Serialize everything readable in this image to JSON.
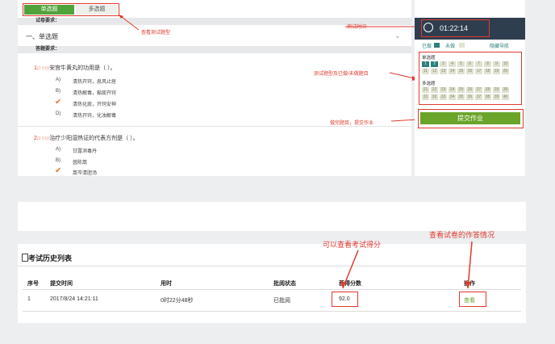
{
  "exam": {
    "type_tabs": [
      "单选题",
      "多选题"
    ],
    "paper_req_label": "试卷要求：",
    "section_title": "一、单选题",
    "answer_req_label": "答题要求：",
    "questions": [
      {
        "num": "1",
        "tag": "(2.0分)",
        "text": "安宫牛黄丸的功用是（ ）。",
        "options": [
          {
            "key": "A)",
            "text": "清热开窍，息风止痉"
          },
          {
            "key": "B)",
            "text": "清热解毒，豁痰开窍"
          },
          {
            "key": "C)",
            "text": "清热化痰，开窍安神"
          },
          {
            "key": "D)",
            "text": "清热开窍，化浊解毒"
          }
        ]
      },
      {
        "num": "2",
        "tag": "(2.0分)",
        "text": "治疗少阳湿热证的代表方剂是（ ）。",
        "options": [
          {
            "key": "A)",
            "text": "甘露消毒丹"
          },
          {
            "key": "B)",
            "text": "茵陈蒿"
          },
          {
            "key": "C)",
            "text": "蒿芩清胆汤"
          }
        ]
      }
    ],
    "annotations": {
      "view_types": "查看测试题型",
      "timer": "测试时间",
      "nav": "测试题型及已做/未做题目",
      "submit": "做完题目，提交作业"
    }
  },
  "sidebar": {
    "timer": "01:22:14",
    "legend": {
      "done": "已做",
      "undone": "未做",
      "hide": "隐藏导航"
    },
    "single_label": "单选题",
    "multi_label": "多选题",
    "single_nums": [
      "1",
      "2",
      "3",
      "4",
      "5",
      "6",
      "7",
      "8",
      "9",
      "10",
      "11",
      "12",
      "13",
      "14",
      "15",
      "16",
      "17",
      "18",
      "19",
      "20"
    ],
    "multi_nums": [
      "21",
      "22",
      "23",
      "24",
      "25",
      "26",
      "27",
      "28",
      "29",
      "30",
      "31",
      "32",
      "33",
      "34",
      "35",
      "36",
      "37",
      "38",
      "39",
      "40"
    ],
    "submit_label": "提交作业",
    "colors": {
      "bg": "#2f3e4f",
      "done": "#2a7f7a",
      "submit": "#6aa42a"
    }
  },
  "history": {
    "title": "考试历史列表",
    "columns": [
      "序号",
      "提交时间",
      "用时",
      "批阅状态",
      "获得分数",
      "操作"
    ],
    "rows": [
      {
        "no": "1",
        "time": "2017/8/24 14:21:11",
        "duration": "0时22分48秒",
        "status": "已批阅",
        "score": "92.0",
        "action": "查看"
      }
    ],
    "annotations": {
      "score": "可以查看考试得分",
      "action": "查看试卷的作答情况"
    }
  }
}
